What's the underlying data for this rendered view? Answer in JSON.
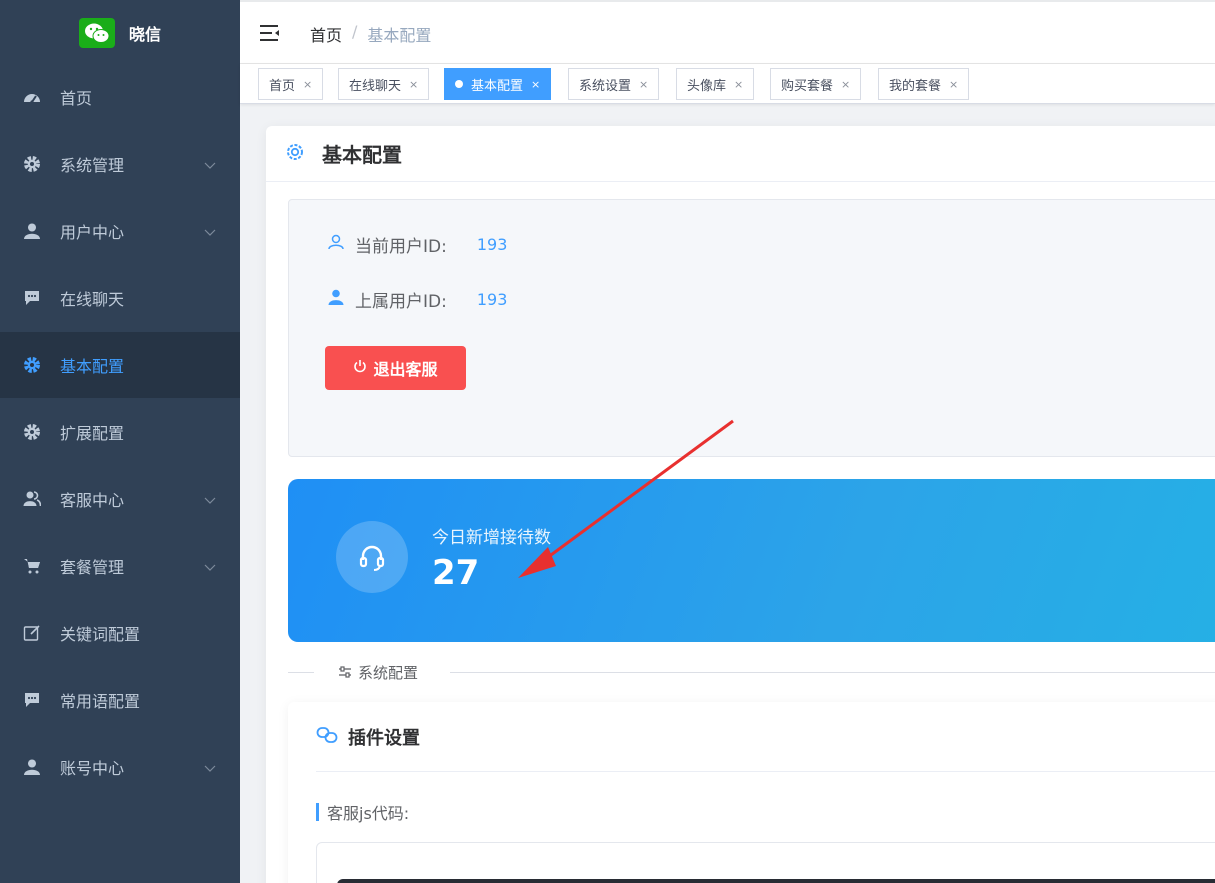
{
  "app": {
    "logo_text": "晓信"
  },
  "sidebar": {
    "items": [
      {
        "label": "首页",
        "icon": "dashboard-icon",
        "expandable": false,
        "active": false
      },
      {
        "label": "系统管理",
        "icon": "gear-icon",
        "expandable": true,
        "active": false
      },
      {
        "label": "用户中心",
        "icon": "user-icon",
        "expandable": true,
        "active": false
      },
      {
        "label": "在线聊天",
        "icon": "chat-icon",
        "expandable": false,
        "active": false
      },
      {
        "label": "基本配置",
        "icon": "gear-icon",
        "expandable": false,
        "active": true
      },
      {
        "label": "扩展配置",
        "icon": "gear-icon",
        "expandable": false,
        "active": false
      },
      {
        "label": "客服中心",
        "icon": "users-icon",
        "expandable": true,
        "active": false
      },
      {
        "label": "套餐管理",
        "icon": "cart-icon",
        "expandable": true,
        "active": false
      },
      {
        "label": "关键词配置",
        "icon": "edit-icon",
        "expandable": false,
        "active": false
      },
      {
        "label": "常用语配置",
        "icon": "chat-icon",
        "expandable": false,
        "active": false
      },
      {
        "label": "账号中心",
        "icon": "user-icon",
        "expandable": true,
        "active": false
      }
    ]
  },
  "header": {
    "breadcrumb": {
      "home": "首页",
      "separator": "/",
      "current": "基本配置"
    }
  },
  "tags": [
    {
      "label": "首页",
      "active": false
    },
    {
      "label": "在线聊天",
      "active": false
    },
    {
      "label": "基本配置",
      "active": true
    },
    {
      "label": "系统设置",
      "active": false
    },
    {
      "label": "头像库",
      "active": false
    },
    {
      "label": "购买套餐",
      "active": false
    },
    {
      "label": "我的套餐",
      "active": false
    }
  ],
  "tag_close_glyph": "×",
  "main": {
    "title": "基本配置",
    "current_user": {
      "label": "当前用户ID:",
      "value": "193"
    },
    "parent_user": {
      "label": "上属用户ID:",
      "value": "193"
    },
    "logout_label": "退出客服",
    "stat": {
      "label": "今日新增接待数",
      "value": "27"
    },
    "section_divider": "系统配置",
    "plugin": {
      "title": "插件设置",
      "js_label": "客服js代码:"
    }
  },
  "colors": {
    "sidebar_bg": "#304156",
    "accent": "#409eff",
    "danger": "#f95050",
    "annotation_arrow": "#e8302f"
  }
}
